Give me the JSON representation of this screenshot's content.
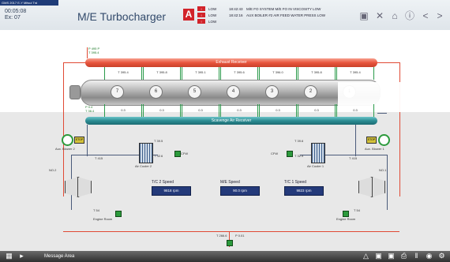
{
  "window_title": "GMS 2017 E-Y Mitsui Trd",
  "clock": {
    "time": "00:05:08",
    "ex": "Ex: 07"
  },
  "page_title": "M/E Turbocharger",
  "alarm_letter": "A",
  "alarms": [
    {
      "sev": "!",
      "level": "LOW",
      "time": "18:42:43",
      "message": "M/E FO SYSTEM M/E FO IN VISCOSITY LOW"
    },
    {
      "sev": "!",
      "level": "LOW",
      "time": "18:42:16",
      "message": "AUX BOILER      #2 AIR FEED WATER PRESS LOW"
    },
    {
      "sev": "!",
      "level": "LOW",
      "time": "",
      "message": ""
    }
  ],
  "toolbar_icons": [
    "window-icon",
    "tools-icon",
    "home-icon",
    "info-icon",
    "prev-icon",
    "next-icon"
  ],
  "receivers": {
    "exhaust": "Exhaust Receiver",
    "scavenge": "Scavenge Air Receiver"
  },
  "exhaust_inlet": {
    "line1": "P 495 P",
    "line2": "T 395.4"
  },
  "scav_inlet": {
    "line1": "P 0.4",
    "line2": "T 36.4"
  },
  "cylinders": [
    "7",
    "6",
    "5",
    "4",
    "3",
    "2",
    "1"
  ],
  "exhaust_temps": [
    "T 395.4",
    "T 395.8",
    "T 395.1",
    "T 395.6",
    "T 396.0",
    "T 395.8",
    "T 395.4"
  ],
  "scav_values": [
    "0.3",
    "0.3",
    "0.3",
    "0.3",
    "0.3",
    "0.3",
    "0.3"
  ],
  "blowers": [
    {
      "label": "Aux. Blower 2",
      "badge": "STOP"
    },
    {
      "label": "Aux. Blower 1",
      "badge": "STOP"
    }
  ],
  "coolers": [
    {
      "label": "Air Cooler 2",
      "in": "T 39.5",
      "out": "T 32.6"
    },
    {
      "label": "Air Cooler 1",
      "in": "T 39.6",
      "out": "T 32.9"
    }
  ],
  "cooler_cw": [
    "CFW",
    "CFW"
  ],
  "turbo_labels": [
    "NO.2",
    "NO.1"
  ],
  "turbo_temps": [
    {
      "gas_out": "T 415",
      "air_in": "T 54"
    },
    {
      "gas_out": "T 415",
      "air_in": "T 54"
    }
  ],
  "engine_room": [
    "Engine Room",
    "Engine Room"
  ],
  "speeds": [
    {
      "label": "T/C 2 Speed",
      "value": "9818 rpm"
    },
    {
      "label": "M/E Speed",
      "value": "90.0 rpm"
    },
    {
      "label": "T/C 1 Speed",
      "value": "9823 rpm"
    }
  ],
  "funnel": {
    "t": "T 266.6",
    "p": "P 0.01"
  },
  "bottom": {
    "message_area": "Message Area"
  }
}
